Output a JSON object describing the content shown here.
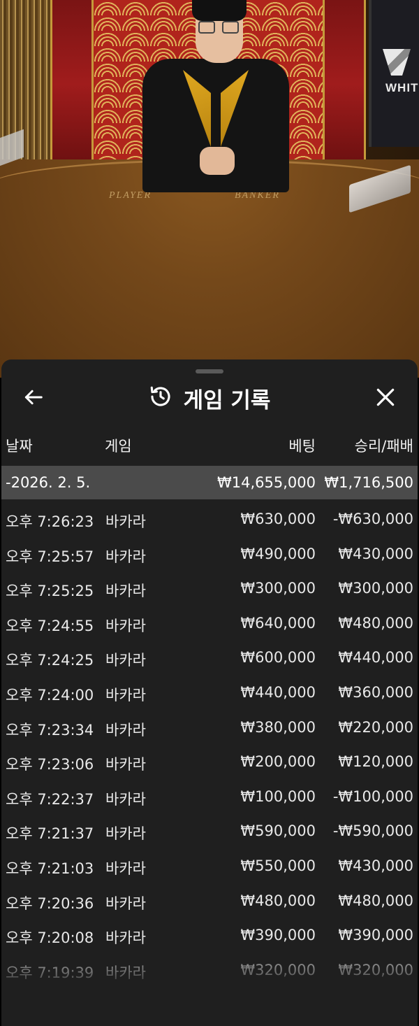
{
  "stage": {
    "table_labels": {
      "player": "PLAYER",
      "banker": "BANKER"
    },
    "screen_brand": "WHIT"
  },
  "sheet": {
    "title": "게임 기록",
    "icons": {
      "back": "arrow-left-icon",
      "history": "history-icon",
      "close": "close-icon"
    },
    "columns": {
      "date": "날짜",
      "game": "게임",
      "bet": "베팅",
      "result": "승리/패배"
    },
    "summary": {
      "date": "-2026. 2. 5.",
      "bet": "₩14,655,000",
      "result": "₩1,716,500"
    },
    "rows": [
      {
        "time": "오후 7:26:23",
        "game": "바카라",
        "bet": "₩630,000",
        "result": "-₩630,000"
      },
      {
        "time": "오후 7:25:57",
        "game": "바카라",
        "bet": "₩490,000",
        "result": "₩430,000"
      },
      {
        "time": "오후 7:25:25",
        "game": "바카라",
        "bet": "₩300,000",
        "result": "₩300,000"
      },
      {
        "time": "오후 7:24:55",
        "game": "바카라",
        "bet": "₩640,000",
        "result": "₩480,000"
      },
      {
        "time": "오후 7:24:25",
        "game": "바카라",
        "bet": "₩600,000",
        "result": "₩440,000"
      },
      {
        "time": "오후 7:24:00",
        "game": "바카라",
        "bet": "₩440,000",
        "result": "₩360,000"
      },
      {
        "time": "오후 7:23:34",
        "game": "바카라",
        "bet": "₩380,000",
        "result": "₩220,000"
      },
      {
        "time": "오후 7:23:06",
        "game": "바카라",
        "bet": "₩200,000",
        "result": "₩120,000"
      },
      {
        "time": "오후 7:22:37",
        "game": "바카라",
        "bet": "₩100,000",
        "result": "-₩100,000"
      },
      {
        "time": "오후 7:21:37",
        "game": "바카라",
        "bet": "₩590,000",
        "result": "-₩590,000"
      },
      {
        "time": "오후 7:21:03",
        "game": "바카라",
        "bet": "₩550,000",
        "result": "₩430,000"
      },
      {
        "time": "오후 7:20:36",
        "game": "바카라",
        "bet": "₩480,000",
        "result": "₩480,000"
      },
      {
        "time": "오후 7:20:08",
        "game": "바카라",
        "bet": "₩390,000",
        "result": "₩390,000"
      },
      {
        "time": "오후 7:19:39",
        "game": "바카라",
        "bet": "₩320,000",
        "result": "₩320,000"
      }
    ]
  }
}
